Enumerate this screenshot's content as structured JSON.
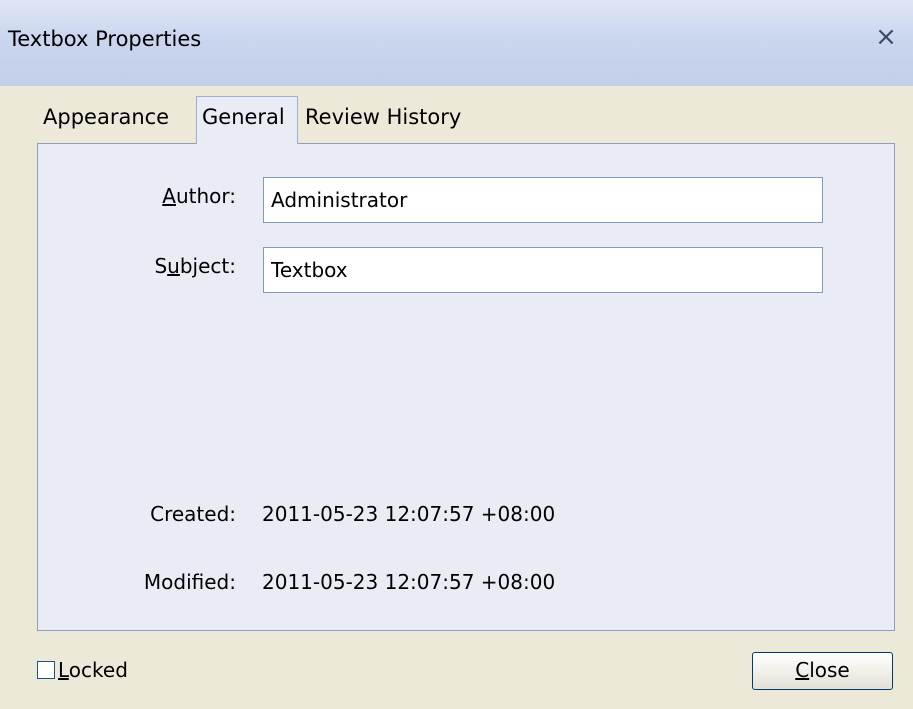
{
  "window": {
    "title": "Textbox Properties",
    "close_glyph": "×"
  },
  "tabs": [
    {
      "label": "Appearance"
    },
    {
      "label": "General",
      "active": true
    },
    {
      "label": "Review History"
    }
  ],
  "general": {
    "author_label_accel": "A",
    "author_label_rest": "uthor:",
    "author_value": "Administrator",
    "subject_label_pre": "S",
    "subject_label_accel": "u",
    "subject_label_rest": "bject:",
    "subject_value": "Textbox",
    "created_label": "Created:",
    "created_value": "2011-05-23 12:07:57 +08:00",
    "modified_label": "Modified:",
    "modified_value": "2011-05-23 12:07:57 +08:00"
  },
  "footer": {
    "locked_accel": "L",
    "locked_rest": "ocked",
    "locked_checked": false,
    "close_accel": "C",
    "close_rest": "lose"
  },
  "icons": {
    "window_close": "close-icon",
    "checkbox": "checkbox-icon"
  },
  "colors": {
    "titlebar_gradient_top": "#dfe7f5",
    "titlebar_gradient_bottom": "#c2cfe9",
    "panel_background": "#e9ecf4",
    "panel_border": "#8f9ec0",
    "dialog_background": "#ece9d8",
    "input_border": "#7f9db9",
    "button_border": "#003c74"
  }
}
